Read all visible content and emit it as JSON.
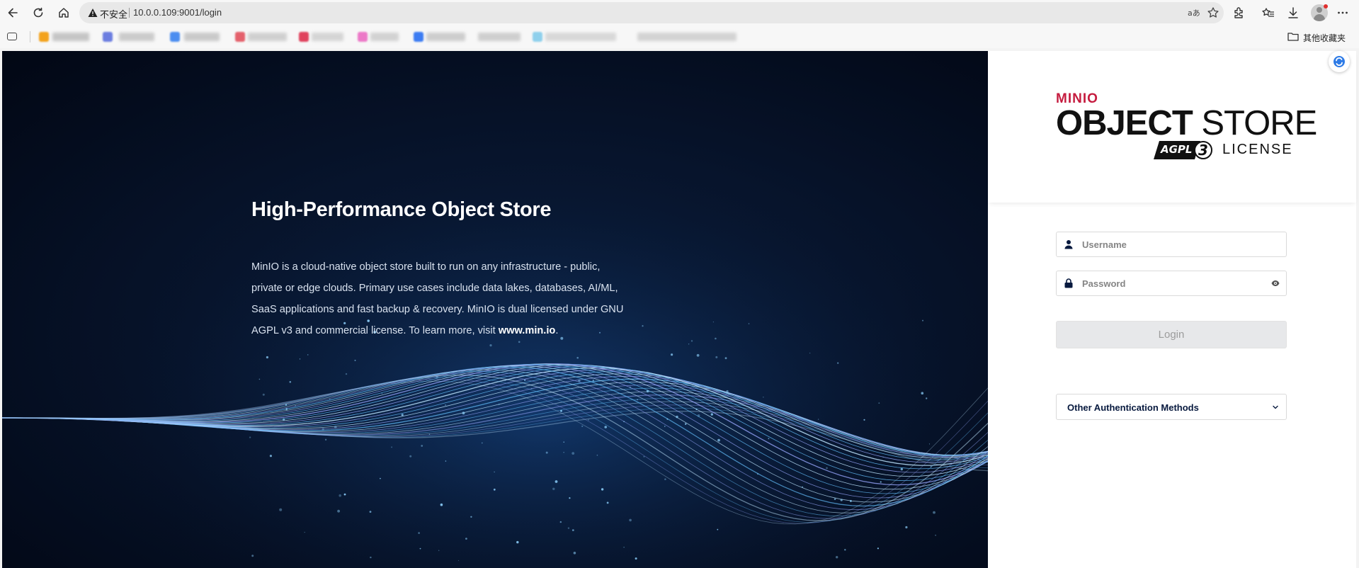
{
  "browser": {
    "insecure_label": "不安全",
    "url": "10.0.0.109:9001/login",
    "bookmarks_folder_label": "其他收藏夹"
  },
  "hero": {
    "title": "High-Performance Object Store",
    "description": "MinIO is a cloud-native object store built to run on any infrastructure - public, private or edge clouds. Primary use cases include data lakes, databases, AI/ML, SaaS applications and fast backup & recovery. MinIO is dual licensed under GNU AGPL v3 and commercial license. To learn more, visit ",
    "link_text": "www.min.io",
    "trailing": "."
  },
  "logo": {
    "brand": "MINIO",
    "product_bold": "OBJECT",
    "product_light": " STORE",
    "badge": "AGPLV3",
    "license": "LICENSE"
  },
  "login": {
    "username_placeholder": "Username",
    "password_placeholder": "Password",
    "login_button": "Login",
    "other_auth": "Other Authentication Methods"
  },
  "colors": {
    "brand_red": "#c51c3f",
    "navy": "#07193e",
    "hero_bg": "#020714"
  }
}
